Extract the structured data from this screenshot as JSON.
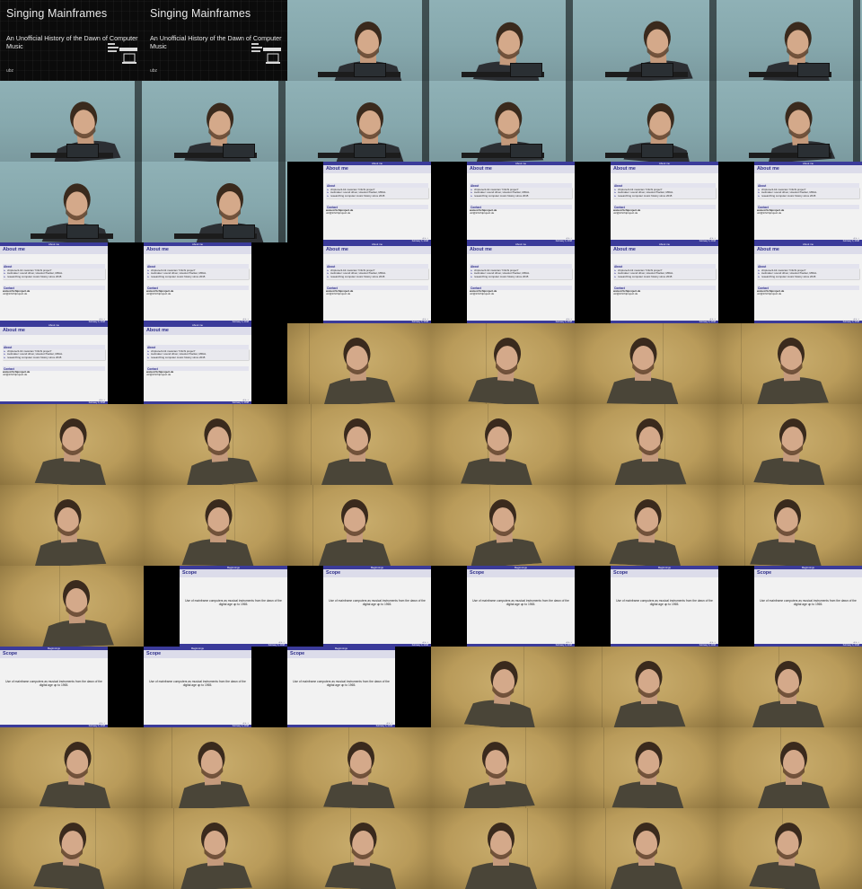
{
  "title_slide": {
    "title": "Singing Mainframes",
    "subtitle": "An Unofficial History of the Dawn of Computer Music",
    "author": "ubz"
  },
  "about_slide": {
    "top_label": "About me",
    "frame_title": "About me",
    "about_heading": "About",
    "about_items": [
      "chiptune/1-bit musician \"irrlicht project\"",
      "toolmaker: sound driver, HoustonTracker, MDAL",
      "researching computer music history since 2015"
    ],
    "contact_heading": "Contact",
    "contact_url": "www.irrlichtproject.de",
    "contact_email": "utz@irrlichtproject.de",
    "footer_right": "February 3, 2018"
  },
  "scope_slide": {
    "top_label": "Beginnings",
    "frame_title": "Scope",
    "body": "Use of mainframe computers as musical instruments from the dawn of the digital age up to 1965.",
    "footer_right": "February 3, 2018"
  },
  "grid": [
    [
      "title",
      "title",
      "cam-blue",
      "cam-blue",
      "cam-blue",
      "cam-blue"
    ],
    [
      "cam-blue",
      "cam-blue",
      "cam-blue",
      "cam-blue",
      "cam-blue",
      "cam-blue"
    ],
    [
      "cam-blue",
      "cam-blue",
      "about-right",
      "about-right",
      "about-right",
      "about-right"
    ],
    [
      "about-left",
      "about-left",
      "about-right",
      "about-right",
      "about-right",
      "about-right"
    ],
    [
      "about-left",
      "about-left",
      "cam-gold",
      "cam-gold",
      "cam-gold",
      "cam-gold"
    ],
    [
      "cam-gold",
      "cam-gold",
      "cam-gold",
      "cam-gold",
      "cam-gold",
      "cam-gold"
    ],
    [
      "cam-gold",
      "cam-gold",
      "cam-gold",
      "cam-gold",
      "cam-gold",
      "cam-gold"
    ],
    [
      "cam-gold",
      "scope-right",
      "scope-right",
      "scope-right",
      "scope-right",
      "scope-right"
    ],
    [
      "scope-left",
      "scope-left",
      "scope-left",
      "cam-gold",
      "cam-gold",
      "cam-gold"
    ],
    [
      "cam-gold",
      "cam-gold",
      "cam-gold",
      "cam-gold",
      "cam-gold",
      "cam-gold"
    ],
    [
      "cam-gold",
      "cam-gold",
      "cam-gold",
      "cam-gold",
      "cam-gold",
      "cam-gold"
    ]
  ]
}
